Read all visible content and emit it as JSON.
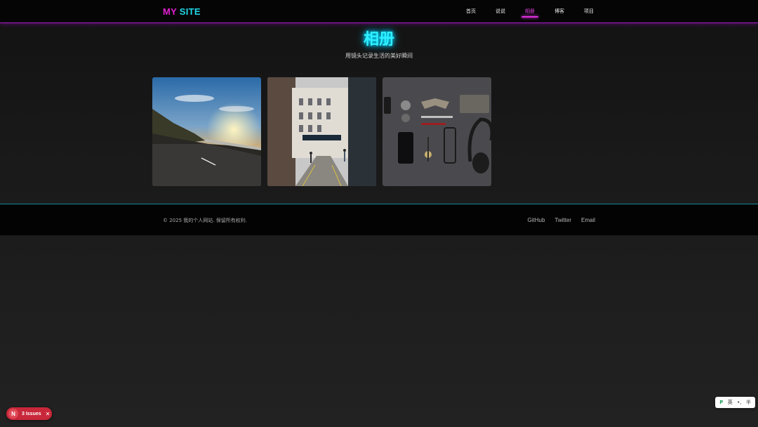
{
  "header": {
    "logo_part1": "MY",
    "logo_part2": "SITE",
    "nav": [
      {
        "label": "首页",
        "active": false
      },
      {
        "label": "说说",
        "active": false
      },
      {
        "label": "相册",
        "active": true
      },
      {
        "label": "博客",
        "active": false
      },
      {
        "label": "项目",
        "active": false
      }
    ]
  },
  "main": {
    "title": "相册",
    "subtitle": "用镜头记录生活的美好瞬间",
    "photos": [
      {
        "icon": "road-sunset-photo"
      },
      {
        "icon": "street-buildings-photo"
      },
      {
        "icon": "flatlay-accessories-photo"
      }
    ]
  },
  "footer": {
    "copyright": "© 2025 我的个人网站. 保留所有权利.",
    "links": [
      "GitHub",
      "Twitter",
      "Email"
    ]
  },
  "issues_badge": {
    "logo": "N",
    "label": "3 Issues",
    "close": "✕"
  },
  "ime": {
    "logo": "P",
    "lang": "英",
    "punct": "•,",
    "width": "半"
  },
  "colors": {
    "accent_magenta": "#e020d0",
    "accent_cyan": "#20d8e8"
  }
}
